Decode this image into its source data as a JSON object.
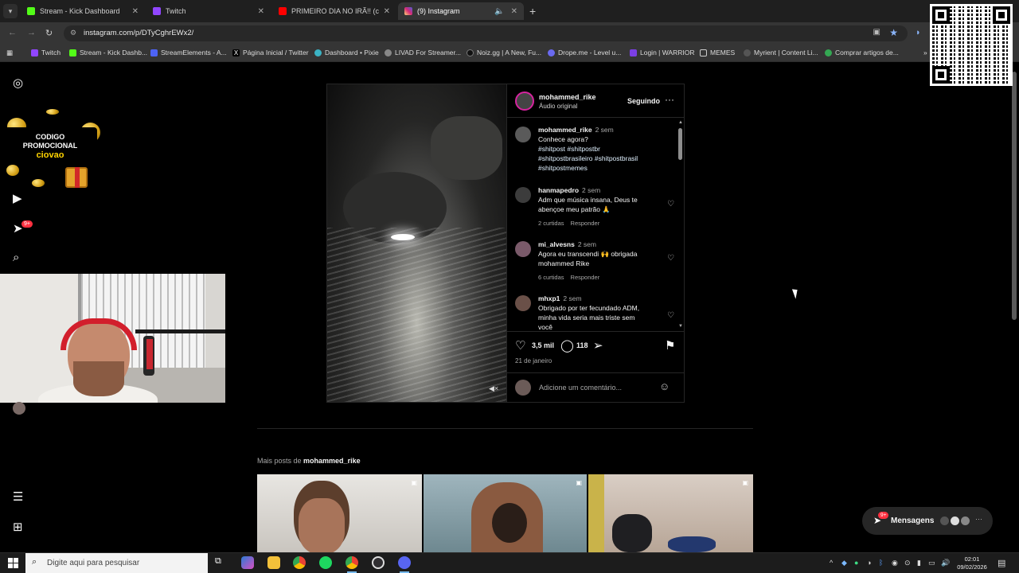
{
  "browser": {
    "tabs": [
      {
        "title": "Stream - Kick Dashboard",
        "color": "#53fc18"
      },
      {
        "title": "Twitch",
        "color": "#9146ff"
      },
      {
        "title": "PRIMEIRO DIA NO IRÃ!! (comi",
        "color": "#ff0000"
      },
      {
        "title": "(9) Instagram",
        "color": "#d6249f"
      }
    ],
    "url": "instagram.com/p/DTyCghrEWx2/",
    "bookmarks": [
      "Twitch",
      "Stream - Kick Dashb...",
      "StreamElements - A...",
      "Página Inicial / Twitter",
      "Dashboard • Pixie",
      "LIVAD For Streamer...",
      "Noiz.gg | A New, Fu...",
      "Drope.me - Level u...",
      "Login | WARRIOR",
      "MEMES",
      "Myrient | Content Li...",
      "Comprar artigos de..."
    ]
  },
  "promo": {
    "line1": "CODIGO",
    "line2": "PROMOCIONAL",
    "code": "ciovao"
  },
  "sidebar": {
    "notification_badge": "9+"
  },
  "post": {
    "author": "mohammed_rike",
    "audio": "Áudio original",
    "follow_label": "Seguindo",
    "caption": {
      "user": "mohammed_rike",
      "time": "2 sem",
      "text": "Conhece agora?",
      "hashtags_line1": "#shitpost #shitpostbr",
      "hashtags_line2": "#shitpostbrasileiro #shitpostbrasil",
      "hashtags_line3": "#shitpostmemes"
    },
    "comments": [
      {
        "user": "hanmapedro",
        "time": "2 sem",
        "line1": "Adm que música insana, Deus te",
        "line2": "abençoe meu patrão 🙏",
        "likes": "2 curtidas",
        "reply": "Responder"
      },
      {
        "user": "mi_alvesns",
        "time": "2 sem",
        "line1": "Agora eu transcendi 🙌 obrigada",
        "line2": "mohammed Rike",
        "likes": "6 curtidas",
        "reply": "Responder"
      },
      {
        "user": "mhxp1",
        "time": "2 sem",
        "line1": "Obrigado por ter fecundado ADM,",
        "line2": "minha vida seria mais triste sem",
        "line3": "você"
      }
    ],
    "likes": "3,5 mil",
    "comments_count": "118",
    "date": "21 de janeiro",
    "add_comment_placeholder": "Adicione um comentário..."
  },
  "more_posts": {
    "prefix": "Mais posts de",
    "user": "mohammed_rike"
  },
  "messages": {
    "label": "Mensagens",
    "badge": "9+"
  },
  "taskbar": {
    "search_placeholder": "Digite aqui para pesquisar",
    "time": "02:01",
    "date": "09/02/2026"
  }
}
